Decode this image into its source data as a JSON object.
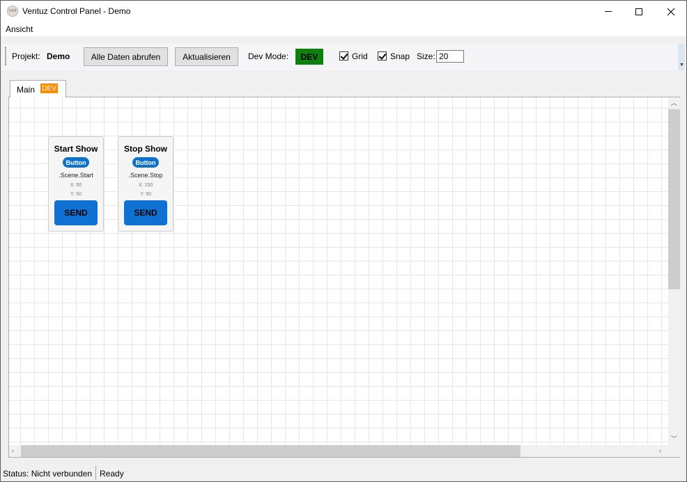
{
  "window": {
    "title": "Ventuz Control Panel - Demo",
    "icon_text": "cml"
  },
  "menu": {
    "items": [
      "Ansicht"
    ]
  },
  "toolbar": {
    "project_label": "Projekt:",
    "project_name": "Demo",
    "fetch_all_label": "Alle Daten abrufen",
    "refresh_label": "Aktualisieren",
    "dev_mode_label": "Dev Mode:",
    "dev_mode_badge": "DEV",
    "grid_label": "Grid",
    "grid_checked": true,
    "snap_label": "Snap",
    "snap_checked": true,
    "size_label": "Size:",
    "size_value": "20"
  },
  "tabs": [
    {
      "label": "Main",
      "badge": "DEV",
      "selected": true
    }
  ],
  "canvas": {
    "grid_on": true,
    "cards": [
      {
        "title": "Start Show",
        "type": "Button",
        "scene": ".Scene.Start",
        "x_label": "X: 50",
        "y_label": "Y: 50",
        "send_label": "SEND"
      },
      {
        "title": "Stop Show",
        "type": "Button",
        "scene": ".Scene.Stop",
        "x_label": "X: 150",
        "y_label": "Y: 50",
        "send_label": "SEND"
      }
    ]
  },
  "statusbar": {
    "status": "Status: Nicht verbunden",
    "state": "Ready"
  },
  "colors": {
    "dev_green": "#0f800f",
    "dev_orange": "#ff8c00",
    "accent_blue": "#0f71d2"
  },
  "icons": {
    "app": "app-logo-icon",
    "minimize": "minimize-icon",
    "maximize": "maximize-icon",
    "close": "close-icon"
  }
}
